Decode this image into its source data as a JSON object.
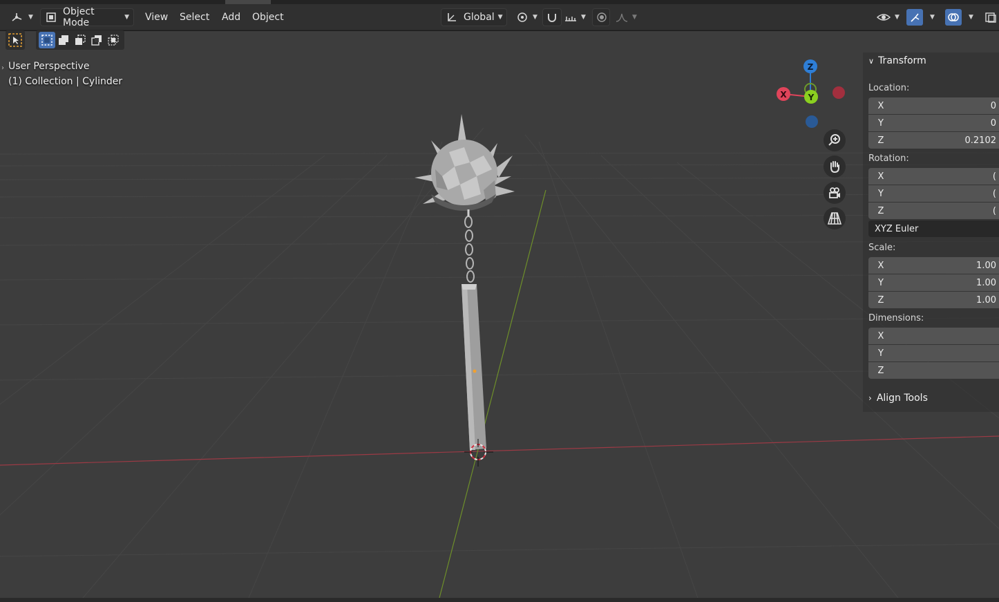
{
  "header": {
    "editor_type_icon": "3d-viewport-icon",
    "mode": "Object Mode",
    "menus": [
      "View",
      "Select",
      "Add",
      "Object"
    ],
    "orientation": "Global"
  },
  "viewport": {
    "view_name": "User Perspective",
    "collection_prefix": "(1) Collection",
    "active_object": "Cylinder"
  },
  "gizmo": {
    "z": "Z",
    "y": "Y",
    "x": "X"
  },
  "npanel": {
    "transform_title": "Transform",
    "location_label": "Location:",
    "location": [
      {
        "axis": "X",
        "value": "0"
      },
      {
        "axis": "Y",
        "value": "0"
      },
      {
        "axis": "Z",
        "value": "0.2102"
      }
    ],
    "rotation_label": "Rotation:",
    "rotation": [
      {
        "axis": "X",
        "value": "("
      },
      {
        "axis": "Y",
        "value": "("
      },
      {
        "axis": "Z",
        "value": "("
      }
    ],
    "rotation_mode": "XYZ Euler",
    "scale_label": "Scale:",
    "scale": [
      {
        "axis": "X",
        "value": "1.00"
      },
      {
        "axis": "Y",
        "value": "1.00"
      },
      {
        "axis": "Z",
        "value": "1.00"
      }
    ],
    "dimensions_label": "Dimensions:",
    "dimensions": [
      {
        "axis": "X",
        "value": ""
      },
      {
        "axis": "Y",
        "value": ""
      },
      {
        "axis": "Z",
        "value": ""
      }
    ],
    "align_tools": "Align Tools"
  },
  "colors": {
    "x_axis": "#e0445a",
    "y_axis": "#8bd020",
    "z_axis": "#2e7ed6",
    "accent": "#4772b3",
    "tool_highlight": "#e5a134"
  }
}
